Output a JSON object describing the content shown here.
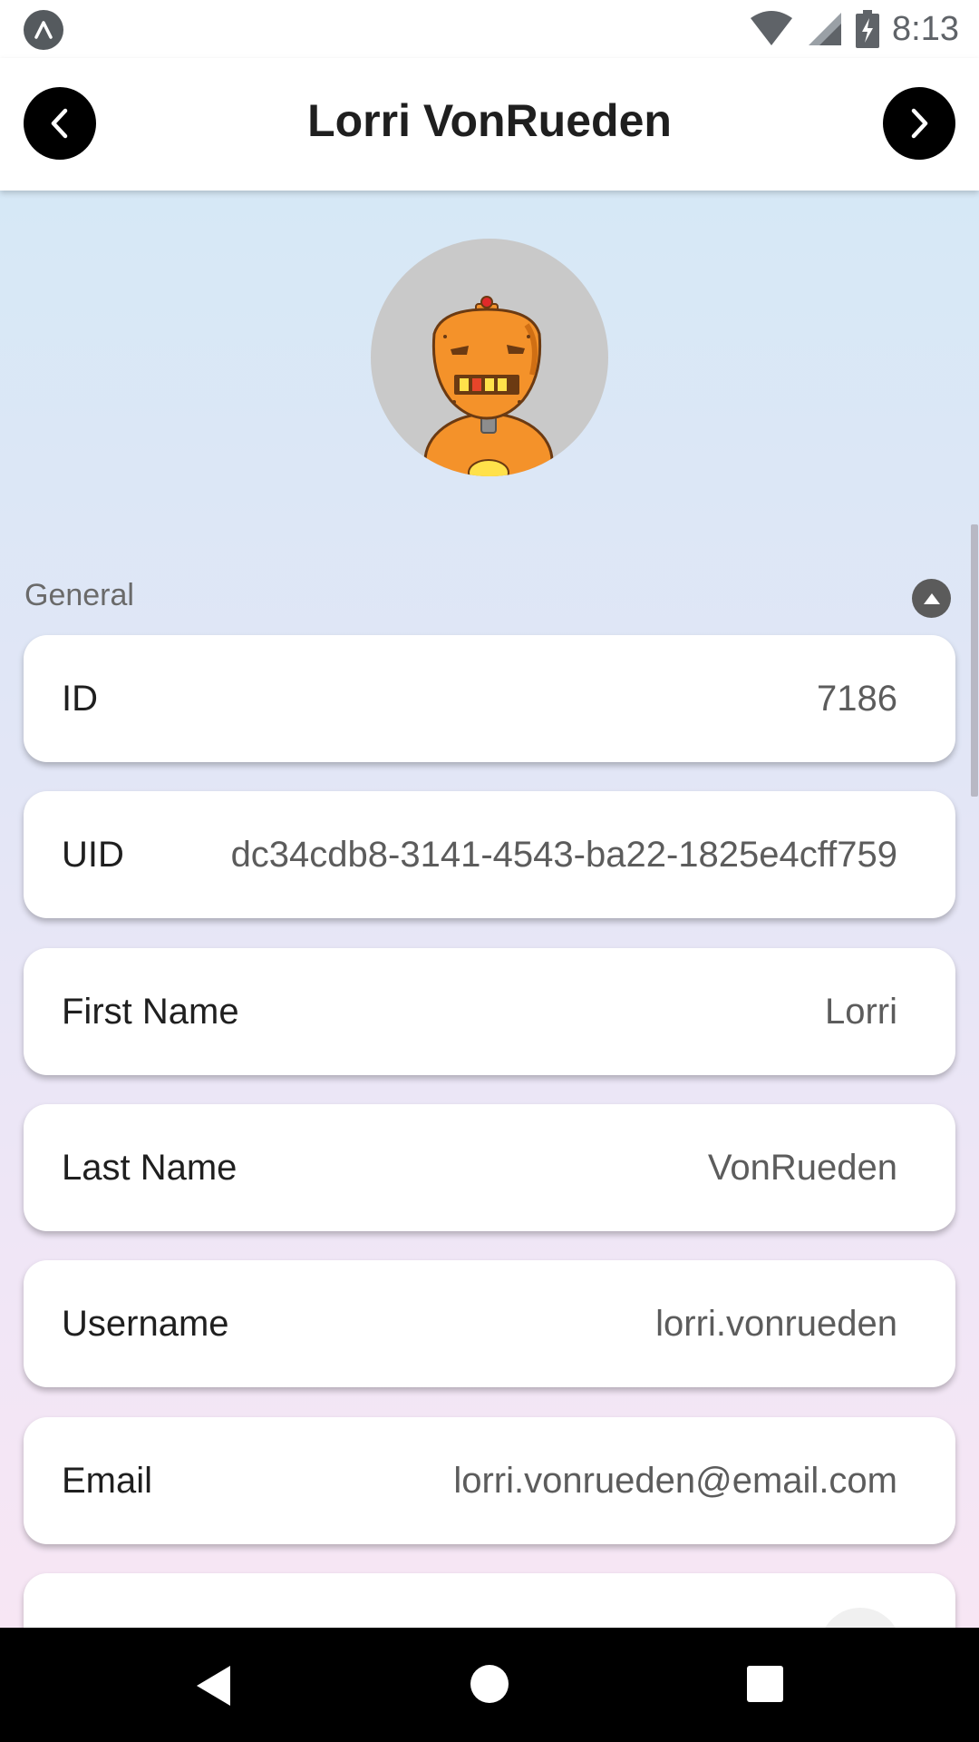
{
  "status_bar": {
    "time": "8:13",
    "icons": [
      "app-notification-icon",
      "wifi-icon",
      "signal-icon",
      "battery-charging-icon"
    ]
  },
  "header": {
    "title": "Lorri VonRueden",
    "prev_icon": "chevron-left-icon",
    "next_icon": "chevron-right-icon"
  },
  "profile": {
    "avatar_icon": "robot-avatar",
    "avatar_bg": "#c9c9c9"
  },
  "section": {
    "title": "General",
    "toggle_icon": "collapse-up-icon"
  },
  "fields": [
    {
      "label": "ID",
      "value": "7186"
    },
    {
      "label": "UID",
      "value": "dc34cdb8-3141-4543-ba22-1825e4cff759"
    },
    {
      "label": "First Name",
      "value": "Lorri"
    },
    {
      "label": "Last Name",
      "value": "VonRueden"
    },
    {
      "label": "Username",
      "value": "lorri.vonrueden"
    },
    {
      "label": "Email",
      "value": "lorri.vonrueden@email.com"
    }
  ],
  "nav_bar": {
    "back_icon": "back-triangle-icon",
    "home_icon": "home-circle-icon",
    "recents_icon": "recents-square-icon"
  },
  "colors": {
    "header_button": "#000000",
    "gradient_top": "#d6e8f6",
    "gradient_bottom": "#f7e6f4"
  }
}
